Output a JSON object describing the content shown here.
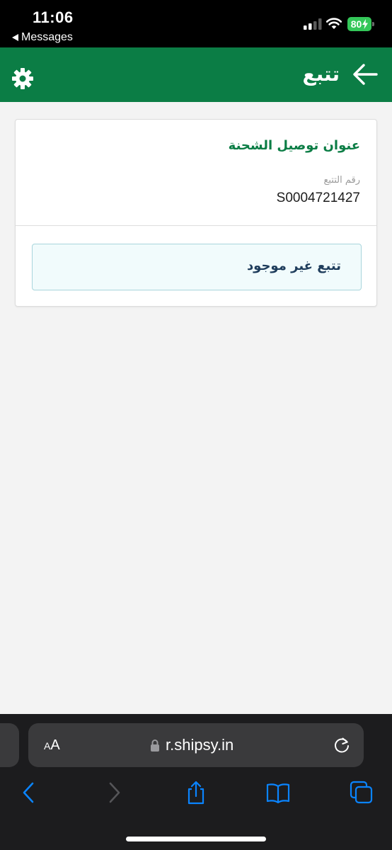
{
  "status_bar": {
    "time": "11:06",
    "back_app": "Messages",
    "battery": "80"
  },
  "header": {
    "title": "تتبع",
    "icons": [
      "back-arrow-icon",
      "gear-icon"
    ]
  },
  "card": {
    "title": "عنوان توصيل الشحنة",
    "tracking_label": "رقم التتبع",
    "tracking_number": "S0004721427",
    "not_found_message": "تتبع غير موجود"
  },
  "browser": {
    "aa_small": "A",
    "aa_big": "A",
    "url": "r.shipsy.in"
  },
  "colors": {
    "header_bg": "#0b7d45",
    "accent_green": "#0b7d45",
    "notice_bg": "#f1fbfc",
    "notice_border": "#a8d5dc",
    "battery_green": "#34c759",
    "ios_blue": "#0a84ff"
  }
}
